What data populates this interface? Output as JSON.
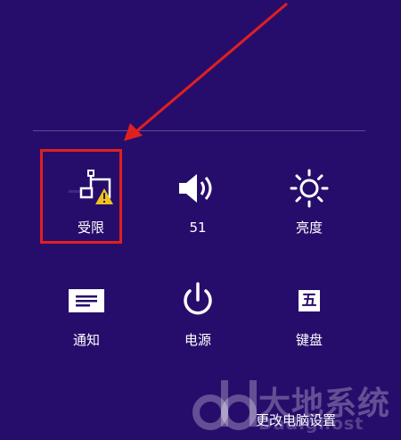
{
  "colors": {
    "background": "#270d6b",
    "divider": "#5c4a96",
    "annotation": "#e02020",
    "warning": "#f0c020"
  },
  "tiles": [
    {
      "id": "network",
      "label": "受限",
      "icon": "network-limited-icon"
    },
    {
      "id": "volume",
      "label": "51",
      "icon": "speaker-icon"
    },
    {
      "id": "brightness",
      "label": "亮度",
      "icon": "brightness-icon"
    },
    {
      "id": "notifications",
      "label": "通知",
      "icon": "notification-icon"
    },
    {
      "id": "power",
      "label": "电源",
      "icon": "power-icon"
    },
    {
      "id": "keyboard",
      "label": "键盘",
      "icon_text": "五"
    }
  ],
  "footer": {
    "change_settings": "更改电脑设置"
  },
  "watermark": {
    "logo_text": "大地系统",
    "logo_subtext": "Dadighost"
  }
}
